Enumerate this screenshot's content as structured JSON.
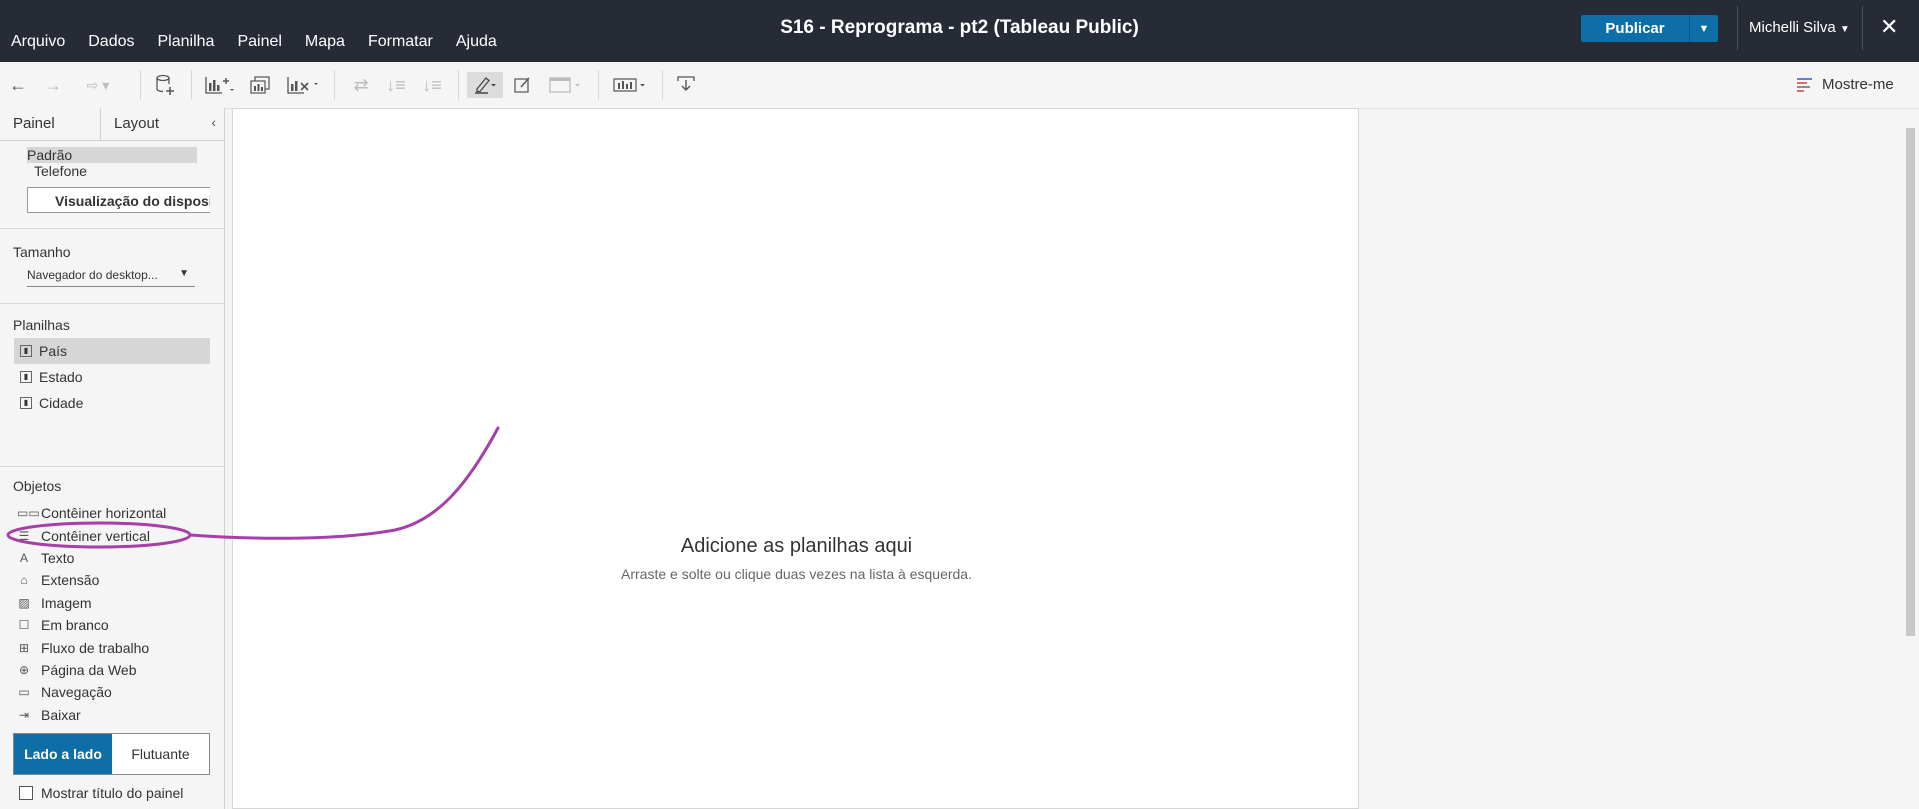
{
  "menu": [
    "Arquivo",
    "Dados",
    "Planilha",
    "Painel",
    "Mapa",
    "Formatar",
    "Ajuda"
  ],
  "window_title": "S16 - Reprograma - pt2 (Tableau Public)",
  "publish_label": "Publicar",
  "user_name": "Michelli Silva",
  "showme_label": "Mostre-me",
  "colors": {
    "topbar": "#262b36",
    "accent": "#0e6ea8",
    "annotation": "#a63fa8"
  },
  "tabs": {
    "painel": "Painel",
    "layout": "Layout"
  },
  "devices": {
    "default": "Padrão",
    "phone": "Telefone",
    "preview_button": "Visualização do disposit"
  },
  "size": {
    "title": "Tamanho",
    "value": "Navegador do desktop..."
  },
  "sheets": {
    "title": "Planilhas",
    "items": [
      "País",
      "Estado",
      "Cidade"
    ]
  },
  "objects": {
    "title": "Objetos",
    "items": [
      {
        "label": "Contêiner horizontal",
        "icon": "horizontal-container-icon"
      },
      {
        "label": "Contêiner vertical",
        "icon": "vertical-container-icon"
      },
      {
        "label": "Texto",
        "icon": "text-icon"
      },
      {
        "label": "Extensão",
        "icon": "extension-icon"
      },
      {
        "label": "Imagem",
        "icon": "image-icon"
      },
      {
        "label": "Em branco",
        "icon": "blank-icon"
      },
      {
        "label": "Fluxo de trabalho",
        "icon": "workflow-icon"
      },
      {
        "label": "Página da Web",
        "icon": "web-page-icon"
      },
      {
        "label": "Navegação",
        "icon": "navigation-icon"
      },
      {
        "label": "Baixar",
        "icon": "download-icon"
      }
    ]
  },
  "layout_mode": {
    "tiled": "Lado a lado",
    "floating": "Flutuante"
  },
  "show_title": "Mostrar título do painel",
  "canvas": {
    "heading": "Adicione as planilhas aqui",
    "subtext": "Arraste e solte ou clique duas vezes na lista à esquerda."
  }
}
